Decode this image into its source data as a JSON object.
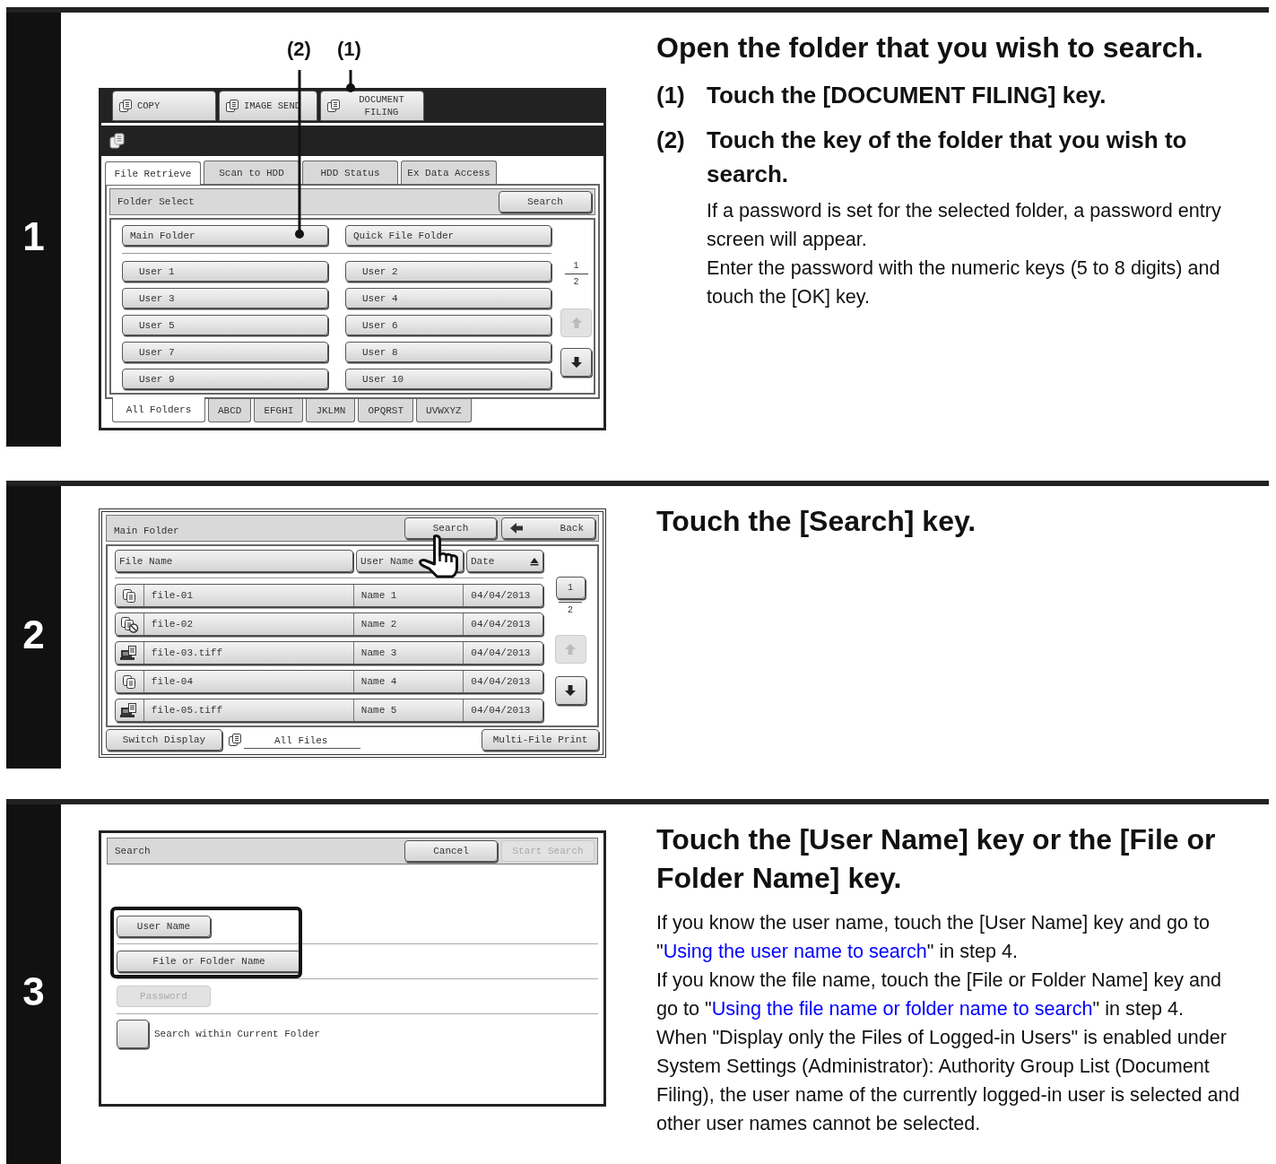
{
  "steps": [
    {
      "number": "1",
      "screen": {
        "kind": "folder_select",
        "callouts": [
          "(2)",
          "(1)"
        ],
        "mode_keys": [
          "COPY",
          "IMAGE SEND",
          "DOCUMENT FILING"
        ],
        "tabs": [
          {
            "label": "File Retrieve",
            "selected": true
          },
          {
            "label": "Scan to HDD",
            "selected": false
          },
          {
            "label": "HDD Status",
            "selected": false
          },
          {
            "label": "Ex Data Access",
            "selected": false
          }
        ],
        "bar_title": "Folder Select",
        "bar_button": "Search",
        "folders": [
          "Main Folder",
          "Quick File Folder"
        ],
        "users": [
          "User 1",
          "User 2",
          "User 3",
          "User 4",
          "User 5",
          "User 6",
          "User 7",
          "User 8",
          "User 9",
          "User 10"
        ],
        "page_current": "1",
        "page_total": "2",
        "up_disabled": true,
        "down_disabled": false,
        "index_tabs": [
          {
            "label": "All Folders",
            "selected": true
          },
          {
            "label": "ABCD",
            "selected": false
          },
          {
            "label": "EFGHI",
            "selected": false
          },
          {
            "label": "JKLMN",
            "selected": false
          },
          {
            "label": "OPQRST",
            "selected": false
          },
          {
            "label": "UVWXYZ",
            "selected": false
          }
        ]
      },
      "heading": "Open the folder that you wish to search.",
      "substeps": [
        {
          "marker": "(1)",
          "text": "Touch the [DOCUMENT FILING] key."
        },
        {
          "marker": "(2)",
          "text": "Touch the key of the folder that you wish to search."
        }
      ],
      "notes": [
        "If a password is set for the selected folder, a password entry screen will appear.",
        "Enter the password with the numeric keys (5 to 8 digits) and touch the [OK] key."
      ]
    },
    {
      "number": "2",
      "screen": {
        "kind": "file_list",
        "title": "Main Folder",
        "buttons": [
          "Search",
          "Back"
        ],
        "columns": [
          {
            "label": "File Name",
            "sorted": false
          },
          {
            "label": "User Name",
            "sorted": false
          },
          {
            "label": "Date",
            "sorted": true
          }
        ],
        "rows": [
          {
            "kind": "copy",
            "file": "file-01",
            "user": "Name 1",
            "date": "04/04/2013"
          },
          {
            "kind": "copy_blocked",
            "file": "file-02",
            "user": "Name 2",
            "date": "04/04/2013"
          },
          {
            "kind": "scan",
            "file": "file-03.tiff",
            "user": "Name 3",
            "date": "04/04/2013"
          },
          {
            "kind": "copy",
            "file": "file-04",
            "user": "Name 4",
            "date": "04/04/2013"
          },
          {
            "kind": "scan",
            "file": "file-05.tiff",
            "user": "Name 5",
            "date": "04/04/2013"
          }
        ],
        "page_current": "1",
        "page_total": "2",
        "up_disabled": true,
        "down_disabled": false,
        "footer": {
          "switch": "Switch Display",
          "view": "All Files",
          "print": "Multi-File Print"
        }
      },
      "heading": "Touch the [Search] key."
    },
    {
      "number": "3",
      "screen": {
        "kind": "search",
        "title": "Search",
        "buttons": [
          {
            "label": "Cancel",
            "disabled": false
          },
          {
            "label": "Start Search",
            "disabled": true
          }
        ],
        "options": [
          {
            "label": "User Name",
            "disabled": false,
            "highlighted": true
          },
          {
            "label": "File or Folder Name",
            "disabled": false,
            "highlighted": true
          },
          {
            "label": "Password",
            "disabled": true,
            "highlighted": false
          }
        ],
        "checkbox": {
          "label": "Search within Current Folder",
          "checked": false
        }
      },
      "heading": "Touch the [User Name] key or the [File or Folder Name] key.",
      "paragraphs": [
        [
          {
            "text": "If you know the user name, touch the [User Name] key and go to \""
          },
          {
            "link": "Using the user name to search"
          },
          {
            "text": "\" in step 4."
          }
        ],
        [
          {
            "text": "If you know the file name, touch the [File or Folder Name] key and go to \""
          },
          {
            "link": "Using the file name or folder name to search"
          },
          {
            "text": "\" in step 4."
          }
        ],
        [
          {
            "text": "When \"Display only the Files of Logged-in Users\" is enabled under System Settings (Administrator): Authority Group List (Document Filing), the user name of the currently logged-in user is selected and other user names cannot be selected."
          }
        ]
      ]
    }
  ]
}
